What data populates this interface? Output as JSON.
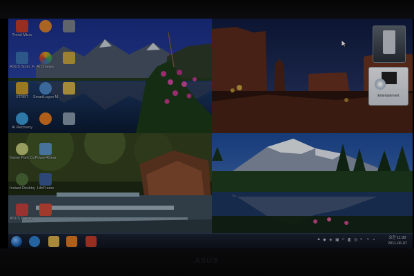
{
  "desktop": {
    "icons": [
      {
        "label": "Trend Micro",
        "color": "#c23b2a"
      },
      {
        "label": "",
        "color": "#d9822b"
      },
      {
        "label": "",
        "color": "#7a7f88"
      },
      {
        "label": "ASUS Sonic Focus",
        "color": "#3a6fb0"
      },
      {
        "label": "Ai Charger",
        "color": "#e0a020"
      },
      {
        "label": "",
        "color": "#c8a640"
      },
      {
        "label": "STRBT",
        "color": "#c79b2c"
      },
      {
        "label": "SmartLogon Manager",
        "color": "#4b86c5"
      },
      {
        "label": "",
        "color": "#d2b04a"
      },
      {
        "label": "AI Recovery",
        "color": "#3c9bd6"
      },
      {
        "label": "",
        "color": "#e07a20"
      },
      {
        "label": "",
        "color": "#8899aa"
      },
      {
        "label": "Game Park Console",
        "color": "#c2c87a"
      },
      {
        "label": "Power4Gear",
        "color": "#5a93c8"
      },
      {
        "label": "",
        "color": "#aab4c0"
      },
      {
        "label": "Instant Desktop",
        "color": "#4f6e3a"
      },
      {
        "label": "LifeFrame",
        "color": "#3a5b9a"
      },
      {
        "label": "",
        "color": "#c9cdd2"
      },
      {
        "label": "ASUS Gaming",
        "color": "#c74040"
      },
      {
        "label": "",
        "color": "#d04a3a"
      }
    ]
  },
  "gadgets": {
    "top": {
      "icon": "phone-gadget-icon"
    },
    "bottom": {
      "icon": "entertainment-gadget-icon",
      "label": "Entertainment"
    }
  },
  "taskbar": {
    "pinned": [
      {
        "name": "start-orb",
        "color": "#1d5fb0"
      },
      {
        "name": "internet-explorer-icon",
        "color": "#2f7fd0"
      },
      {
        "name": "folder-icon",
        "color": "#d8b04a"
      },
      {
        "name": "media-player-icon",
        "color": "#e07a20"
      },
      {
        "name": "game-icon",
        "color": "#c23b2a"
      }
    ],
    "tray_glyphs": [
      "▲",
      "◆",
      "◈",
      "▣",
      "♫",
      "◧",
      "◎",
      "◐",
      "◑",
      "◒"
    ],
    "clock": {
      "time": "오전 11:30",
      "date": "2011-06-07"
    }
  },
  "colors": {
    "accent": "#2b3a55"
  }
}
